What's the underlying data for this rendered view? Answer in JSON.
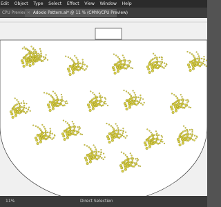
{
  "menubar": {
    "items": [
      {
        "label": "Edit"
      },
      {
        "label": "Object"
      },
      {
        "label": "Type"
      },
      {
        "label": "Select"
      },
      {
        "label": "Effect"
      },
      {
        "label": "View"
      },
      {
        "label": "Window"
      },
      {
        "label": "Help"
      }
    ]
  },
  "tabs": [
    {
      "label": "CPU Preview)",
      "active": false
    },
    {
      "label": "Adoxio Pattern.ai* @ 11 % (CMYK/CPU Preview)",
      "active": true
    }
  ],
  "statusbar": {
    "left": "11%",
    "tool": "Direct Selection",
    "arrow": "▸"
  },
  "colors": {
    "artboard_bg": "#ffffff",
    "pasteboard_bg": "#f0f0f0",
    "dot_fill": "#d9d04a",
    "dot_stroke": "#8c8416",
    "outline": "#444444"
  },
  "motifs_count": 18
}
